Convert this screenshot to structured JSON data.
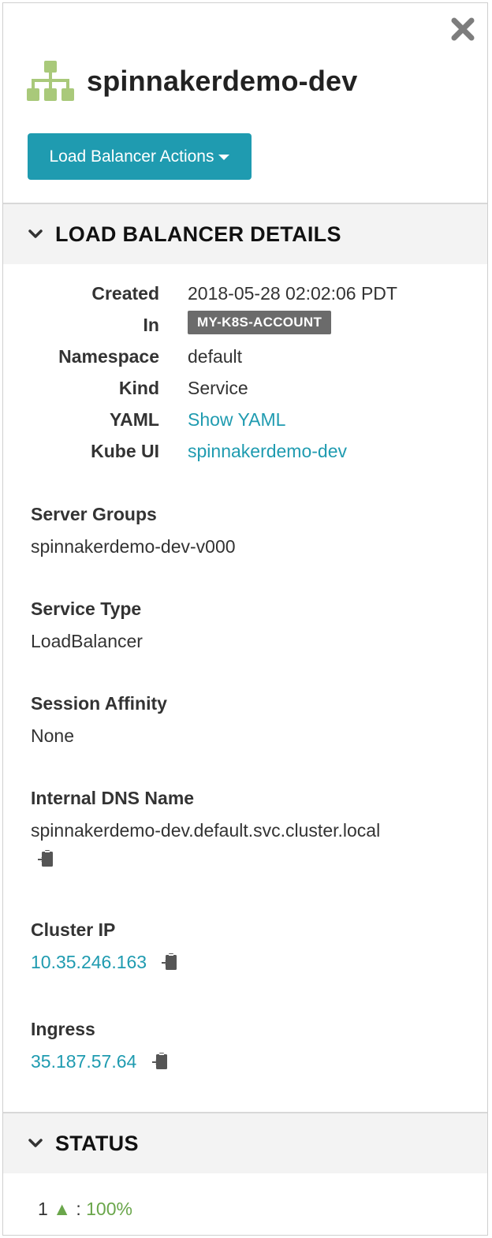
{
  "header": {
    "title": "spinnakerdemo-dev",
    "actions_label": "Load Balancer Actions",
    "app_icon": "sitemap-icon",
    "close_icon": "close-icon"
  },
  "details_section": {
    "label": "LOAD BALANCER DETAILS",
    "rows": [
      {
        "key": "Created",
        "value": "2018-05-28 02:02:06 PDT"
      },
      {
        "key": "In",
        "value": "MY-K8S-ACCOUNT"
      },
      {
        "key": "Namespace",
        "value": "default"
      },
      {
        "key": "Kind",
        "value": "Service"
      },
      {
        "key": "YAML",
        "value": "Show YAML"
      },
      {
        "key": "Kube UI",
        "value": "spinnakerdemo-dev"
      }
    ],
    "server_groups": {
      "label": "Server Groups",
      "value": "spinnakerdemo-dev-v000"
    },
    "service_type": {
      "label": "Service Type",
      "value": "LoadBalancer"
    },
    "session_affinity": {
      "label": "Session Affinity",
      "value": "None"
    },
    "internal_dns": {
      "label": "Internal DNS Name",
      "value": "spinnakerdemo-dev.default.svc.cluster.local"
    },
    "cluster_ip": {
      "label": "Cluster IP",
      "value": "10.35.246.163"
    },
    "ingress": {
      "label": "Ingress",
      "value": "35.187.57.64"
    }
  },
  "status_section": {
    "label": "STATUS",
    "count": "1",
    "arrow": "▲",
    "separator": ":",
    "percent": "100%"
  },
  "colors": {
    "accent": "#1f9bb0",
    "app_icon": "#a9c97a",
    "healthy": "#6aa64b",
    "badge_bg": "#6b6b6b"
  }
}
